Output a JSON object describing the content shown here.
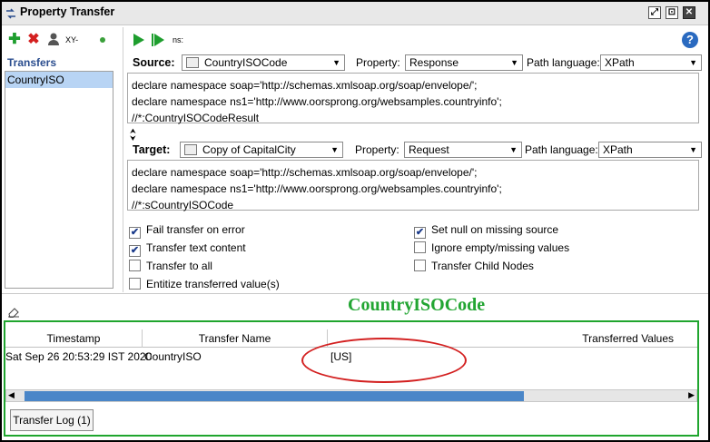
{
  "window": {
    "title": "Property Transfer"
  },
  "left_toolbar": {
    "xy_label": "XY-"
  },
  "transfers": {
    "heading": "Transfers",
    "items": [
      "CountryISO"
    ]
  },
  "right_toolbar": {
    "ns_label": "ns:"
  },
  "source": {
    "label": "Source:",
    "step": "CountryISOCode",
    "property_label": "Property:",
    "property": "Response",
    "path_language_label": "Path language:",
    "path_language": "XPath",
    "expression_lines": [
      "declare namespace soap='http://schemas.xmlsoap.org/soap/envelope/';",
      "declare namespace ns1='http://www.oorsprong.org/websamples.countryinfo';",
      "//*:CountryISOCodeResult"
    ]
  },
  "target": {
    "label": "Target:",
    "step": "Copy of CapitalCity",
    "property_label": "Property:",
    "property": "Request",
    "path_language_label": "Path language:",
    "path_language": "XPath",
    "expression_lines": [
      "declare namespace soap='http://schemas.xmlsoap.org/soap/envelope/';",
      "declare namespace ns1='http://www.oorsprong.org/websamples.countryinfo';",
      "//*:sCountryISOCode"
    ]
  },
  "options": {
    "fail_on_error": {
      "label": "Fail transfer on error",
      "checked": true
    },
    "transfer_text": {
      "label": "Transfer text content",
      "checked": true
    },
    "transfer_all": {
      "label": "Transfer to all",
      "checked": false
    },
    "entitize": {
      "label": "Entitize transferred value(s)",
      "checked": false
    },
    "set_null": {
      "label": "Set null on missing source",
      "checked": true
    },
    "ignore_empty": {
      "label": "Ignore empty/missing values",
      "checked": false
    },
    "child_nodes": {
      "label": "Transfer Child Nodes",
      "checked": false
    }
  },
  "annotation": {
    "title": "CountryISOCode",
    "color": "#22a532",
    "ellipse_color": "#d32020"
  },
  "log_table": {
    "columns": [
      "Timestamp",
      "Transfer Name",
      "Transferred Values"
    ],
    "rows": [
      {
        "timestamp": "Sat Sep 26 20:53:29 IST 2020",
        "name": "CountryISO",
        "values": "[US]"
      }
    ]
  },
  "log_button": "Transfer Log (1)",
  "colors": {
    "accent": "#2a4d8e",
    "selection": "#b8d4f4",
    "scroll_thumb": "#4a86c8"
  }
}
